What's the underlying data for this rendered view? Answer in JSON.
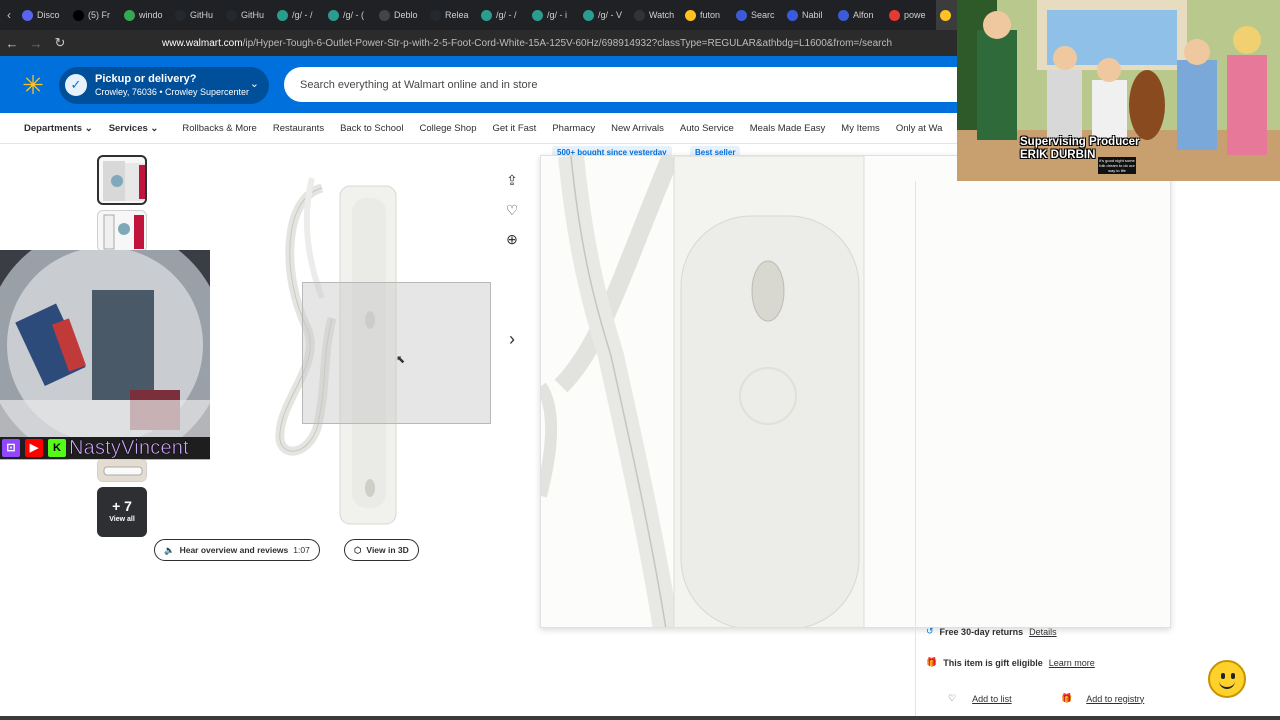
{
  "browser": {
    "tabs": [
      {
        "label": "Disco",
        "color": "#5865f2",
        "icon": "discord-icon"
      },
      {
        "label": "(5) Fr",
        "color": "#000000",
        "icon": "x-icon"
      },
      {
        "label": "windo",
        "color": "#34a853",
        "icon": "chrome-icon"
      },
      {
        "label": "GitHu",
        "color": "#24292f",
        "icon": "github-icon"
      },
      {
        "label": "GitHu",
        "color": "#24292f",
        "icon": "github-icon"
      },
      {
        "label": "/g/ - /",
        "color": "#2a9d8f",
        "icon": "board-icon"
      },
      {
        "label": "/g/ - (",
        "color": "#2a9d8f",
        "icon": "board-icon"
      },
      {
        "label": "Deblo",
        "color": "#444444",
        "icon": "page-icon"
      },
      {
        "label": "Relea",
        "color": "#24292f",
        "icon": "github-icon"
      },
      {
        "label": "/g/ - /",
        "color": "#2a9d8f",
        "icon": "board-icon"
      },
      {
        "label": "/g/ - i",
        "color": "#2a9d8f",
        "icon": "board-icon"
      },
      {
        "label": "/g/ - V",
        "color": "#2a9d8f",
        "icon": "board-icon"
      },
      {
        "label": "Watch",
        "color": "#333333",
        "icon": "m-icon"
      },
      {
        "label": "futon",
        "color": "#ffc220",
        "icon": "walmart-icon"
      },
      {
        "label": "Searc",
        "color": "#3b5bdb",
        "icon": "c-icon"
      },
      {
        "label": "Nabil",
        "color": "#3b5bdb",
        "icon": "c-icon"
      },
      {
        "label": "Alfon",
        "color": "#3b5bdb",
        "icon": "c-icon"
      },
      {
        "label": "powe",
        "color": "#e53935",
        "icon": "page-icon"
      },
      {
        "label": "",
        "color": "#ffc220",
        "icon": "walmart-icon"
      }
    ],
    "url_host": "www.walmart.com",
    "url_path": "/ip/Hyper-Tough-6-Outlet-Power-Str-p-with-2-5-Foot-Cord-White-15A-125V-60Hz/698914932?classType=REGULAR&athbdg=L1600&from=/search"
  },
  "header": {
    "pickup_title": "Pickup or delivery?",
    "pickup_location": "Crowley, 76036 • Crowley Supercenter",
    "search_placeholder": "Search everything at Walmart online and in store",
    "brand_color": "#0071dc"
  },
  "categories": [
    "Departments",
    "Services",
    "Rollbacks & More",
    "Restaurants",
    "Back to School",
    "College Shop",
    "Get it Fast",
    "Pharmacy",
    "New Arrivals",
    "Auto Service",
    "Meals Made Easy",
    "My Items",
    "Only at Wa"
  ],
  "product": {
    "more_images_count": "+ 7",
    "view_all": "View all",
    "hear_overview": "Hear overview and reviews",
    "overview_duration": "1:07",
    "view_3d": "View in 3D",
    "badge_bought": "500+ bought since yesterday",
    "badge_best": "Best seller"
  },
  "fulfillment": {
    "returns": "Free 30-day returns",
    "returns_link": "Details",
    "gift": "This item is gift eligible",
    "gift_link": "Learn more",
    "add_list": "Add to list",
    "add_registry": "Add to registry"
  },
  "overlays": {
    "streamer_name": "NastyVincent",
    "tv_credit_role": "Supervising Producer",
    "tv_credit_name": "ERIK DURBIN",
    "tv_caption": "it's good night some folk dream to do our way to life"
  }
}
